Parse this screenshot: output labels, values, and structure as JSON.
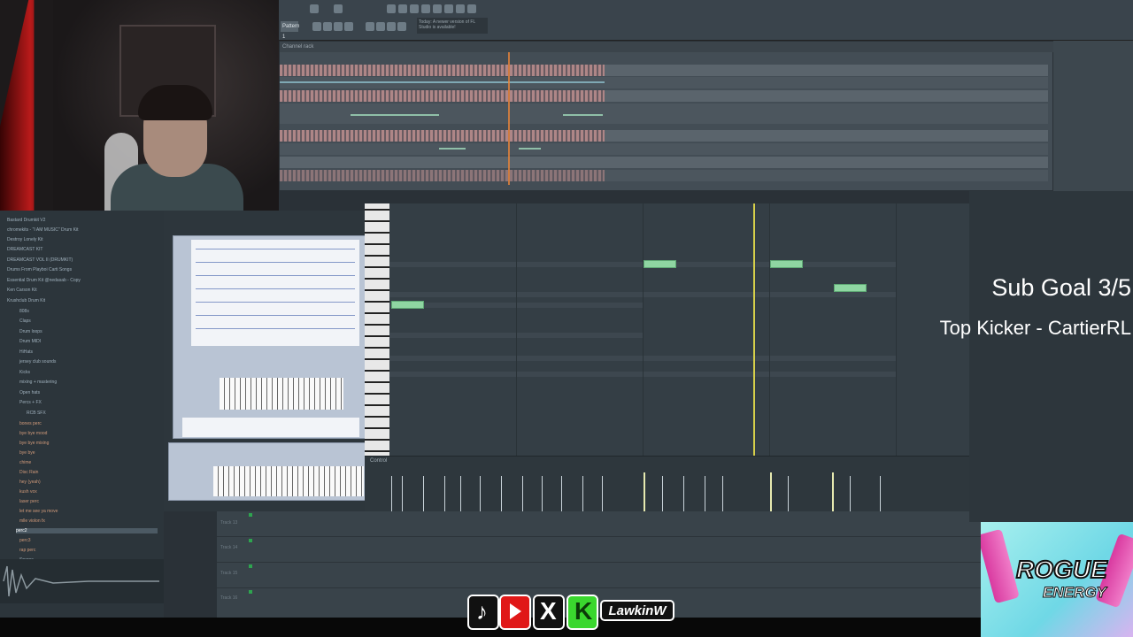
{
  "overlay": {
    "sub_goal": "Sub Goal 3/5",
    "top_kicker": "Top Kicker - CartierRL",
    "social_handle": "LawkinW",
    "sponsor_name": "ROGUE",
    "sponsor_sub": "ENERGY"
  },
  "daw": {
    "pattern": "Pattern 1",
    "channel_rack_title": "Channel rack",
    "control_lane_label": "Control",
    "toolbar_hint": "Today: A newer version of FL Studio is available!"
  },
  "browser": {
    "items": [
      "Bastard Drumkit V2",
      "chromekits - \"I AM MUSIC\" Drum Kit",
      "Destroy Lonely Kit",
      "DREAMCAST KIT",
      "DREAMCAST VOL II (DRUMKIT)",
      "Drums From Playboi Carti Songs",
      "Essential Drum Kit @nedasab - Copy",
      "Ken Carson Kit",
      "Krushclub Drum Kit"
    ],
    "subitems": [
      "808s",
      "Claps",
      "Drum loops",
      "Drum MIDI",
      "HiHats",
      "jersey club sounds",
      "Kicks",
      "mixing + mastering",
      "Open hats",
      "Percs + FX",
      "RCB SFX"
    ],
    "files": [
      "bones perc",
      "bye bye mood",
      "bye bye mixing",
      "bye bye",
      "chime",
      "Disc Rain",
      "hey (yeah)",
      "kush vox",
      "laser perc",
      "let me see ya move",
      "mlle violon fx",
      "perc2",
      "perc3",
      "rap perc",
      "Snares"
    ]
  },
  "playlist_tracks": [
    "Track 13",
    "Track 14",
    "Track 15",
    "Track 16"
  ],
  "icons": [
    "tiktok-icon",
    "youtube-icon",
    "x-icon",
    "kick-icon"
  ]
}
